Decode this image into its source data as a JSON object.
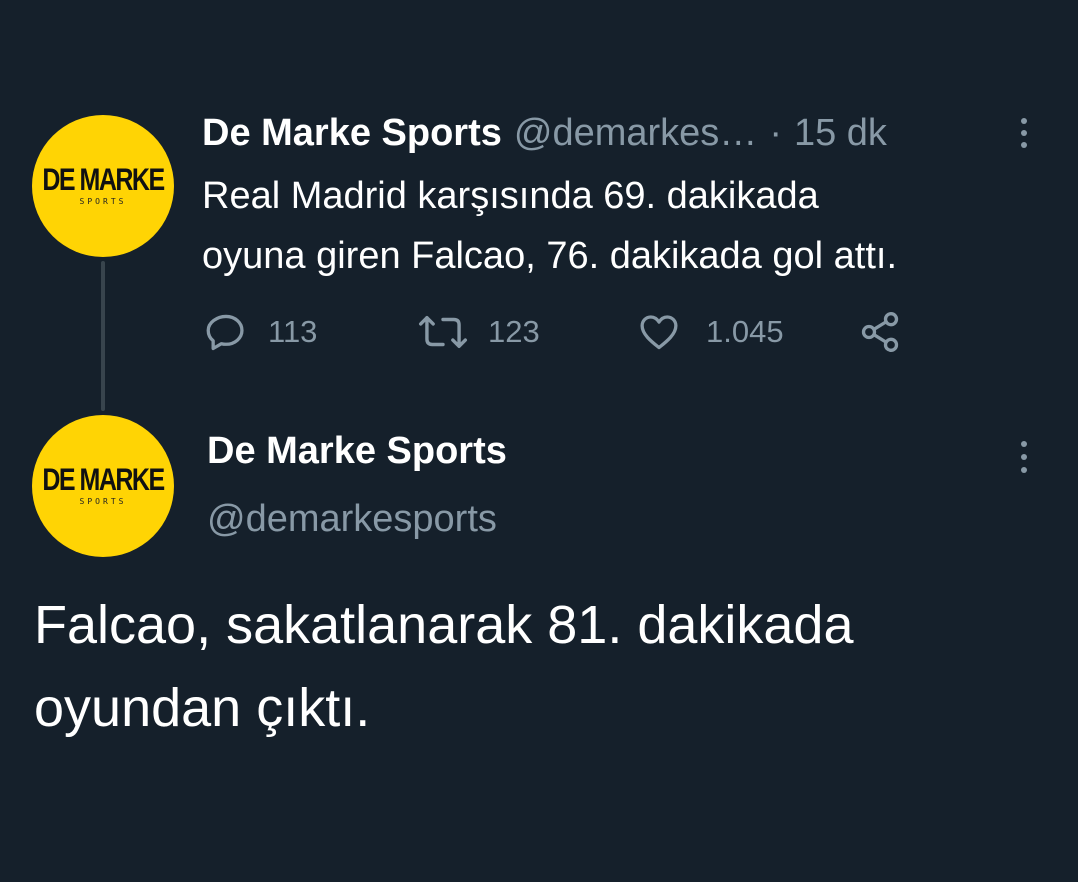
{
  "tweet1": {
    "avatar": {
      "logo_main": "DE MARKE",
      "logo_sub": "SPORTS",
      "bg_color": "#ffd404"
    },
    "display_name": "De Marke Sports",
    "handle": "@demarkes…",
    "separator": "·",
    "time": "15 dk",
    "more_icon": "more-vertical-icon",
    "text_lines": [
      "Real Madrid karşısında 69. dakikada",
      "oyuna giren Falcao, 76. dakikada gol attı."
    ],
    "actions": {
      "reply": {
        "icon": "reply-icon",
        "count": "113"
      },
      "retweet": {
        "icon": "retweet-icon",
        "count": "123"
      },
      "like": {
        "icon": "heart-icon",
        "count": "1.045"
      },
      "share": {
        "icon": "share-icon"
      }
    }
  },
  "tweet2": {
    "avatar": {
      "logo_main": "DE MARKE",
      "logo_sub": "SPORTS",
      "bg_color": "#ffd404"
    },
    "display_name": "De Marke Sports",
    "handle": "@demarkesports",
    "more_icon": "more-vertical-icon",
    "text_lines": [
      "Falcao, sakatlanarak 81. dakikada",
      "oyundan çıktı."
    ]
  },
  "colors": {
    "background": "#15202b",
    "text_primary": "#ffffff",
    "text_secondary": "#8899a6",
    "thread_line": "#38444d"
  }
}
